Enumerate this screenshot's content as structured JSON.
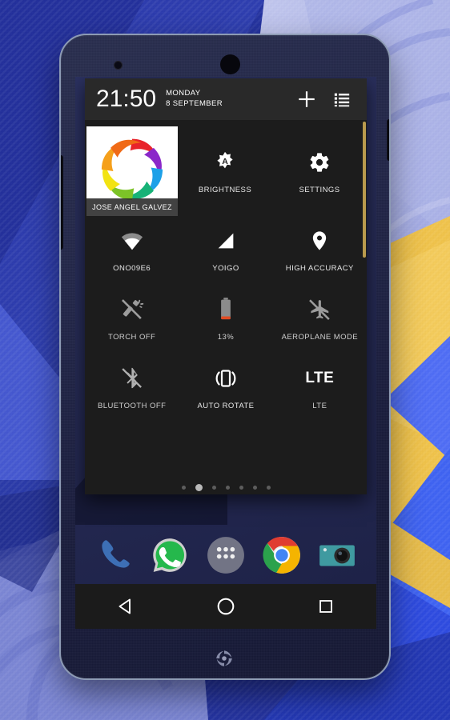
{
  "wallpaper": {
    "description": "abstract geometric blue and yellow material wallpaper",
    "colors": {
      "deep_blue": "#2433a0",
      "mid_blue": "#3f51d8",
      "periwinkle": "#8d96e0",
      "lavender": "#b4bbe8",
      "gold": "#f0c34b",
      "bright_blue": "#4f6df5",
      "navy": "#1b2060"
    }
  },
  "phone": {
    "frame_color": "#23274a",
    "bezel_color": "#8d9bb4",
    "front_camera_icon": "front-camera-icon",
    "earpiece_icon": "earpiece-icon",
    "brand_logo_icon": "shutter-swirl-icon",
    "power_button_icon": "power-button",
    "volume_button_icon": "volume-rocker"
  },
  "quick_settings": {
    "header": {
      "time": "21:50",
      "day": "MONDAY",
      "date": "8 SEPTEMBER",
      "add_icon": "plus-icon",
      "list_icon": "list-icon",
      "background": "#292929"
    },
    "panel_background": "#1c1c1c",
    "profile": {
      "name": "JOSE ANGEL GALVEZ",
      "icon": "rainbow-shutter-logo"
    },
    "tiles": [
      {
        "id": "brightness",
        "label": "BRIGHTNESS",
        "icon": "auto-brightness-icon",
        "state": "auto"
      },
      {
        "id": "settings",
        "label": "SETTINGS",
        "icon": "gear-icon",
        "state": "on"
      },
      {
        "id": "wifi",
        "label": "ONO09E6",
        "icon": "wifi-icon",
        "state": "connected"
      },
      {
        "id": "mobile-network",
        "label": "YOIGO",
        "icon": "signal-bars-icon",
        "state": "connected"
      },
      {
        "id": "location",
        "label": "HIGH ACCURACY",
        "icon": "location-pin-icon",
        "state": "on"
      },
      {
        "id": "torch",
        "label": "TORCH OFF",
        "icon": "flashlight-off-icon",
        "state": "off"
      },
      {
        "id": "battery",
        "label": "13%",
        "icon": "battery-icon",
        "state": "low"
      },
      {
        "id": "aeroplane",
        "label": "AEROPLANE MODE",
        "icon": "airplane-off-icon",
        "state": "off"
      },
      {
        "id": "bluetooth",
        "label": "BLUETOOTH OFF",
        "icon": "bluetooth-off-icon",
        "state": "off"
      },
      {
        "id": "auto-rotate",
        "label": "AUTO ROTATE",
        "icon": "screen-rotate-icon",
        "state": "on"
      },
      {
        "id": "network-mode",
        "label": "LTE",
        "icon": "lte-text-icon",
        "state": "on"
      }
    ],
    "lte_glyph": "LTE",
    "battery_percent": 13,
    "battery_fill_color": "#e04b23",
    "page_dots": {
      "count": 7,
      "active_index": 1
    },
    "scrollbar_color": "#b99a4d"
  },
  "dock": {
    "apps": [
      {
        "id": "phone",
        "icon": "phone-handset-icon",
        "color": "#3d6fb5"
      },
      {
        "id": "whatsapp",
        "icon": "whatsapp-icon",
        "color": "#25d366"
      },
      {
        "id": "app-drawer",
        "icon": "app-drawer-icon",
        "color": "#9aa0a6"
      },
      {
        "id": "chrome",
        "icon": "chrome-icon",
        "color": "#4285f4"
      },
      {
        "id": "camera",
        "icon": "camera-icon",
        "color": "#3f9aa0"
      }
    ]
  },
  "navbar": {
    "buttons": [
      {
        "id": "back",
        "icon": "back-triangle-icon"
      },
      {
        "id": "home",
        "icon": "home-circle-icon"
      },
      {
        "id": "recents",
        "icon": "recents-square-icon"
      }
    ],
    "background": "#1b1b1b"
  }
}
